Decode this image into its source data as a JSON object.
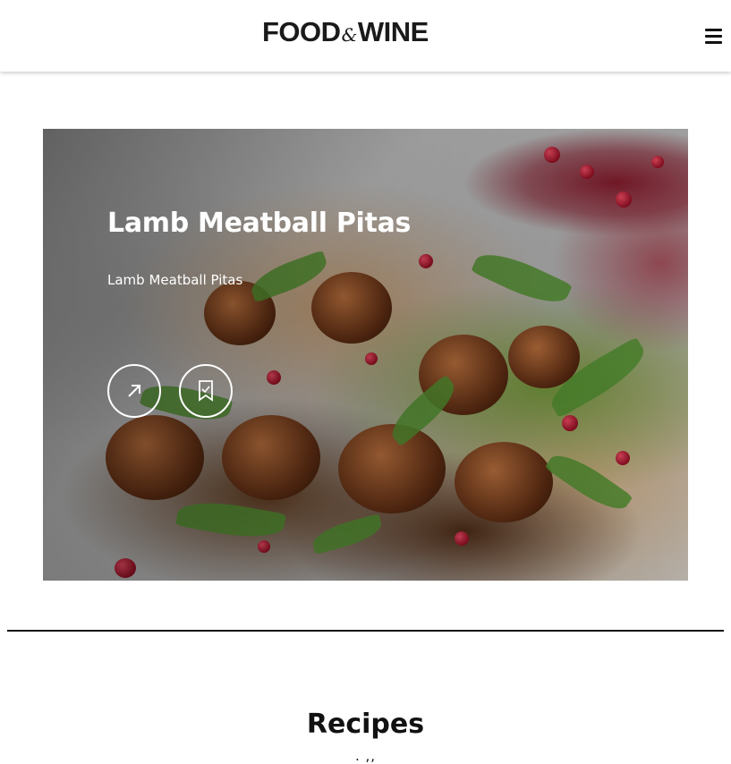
{
  "header": {
    "logo_left": "FOOD",
    "logo_amp": "&",
    "logo_right": "WINE",
    "menu_icon": "hamburger-menu-icon"
  },
  "hero": {
    "title": "Lamb Meatball Pitas",
    "subtitle": "Lamb Meatball Pitas",
    "open_icon": "arrow-up-right-icon",
    "save_icon": "bookmark-icon"
  },
  "section": {
    "heading": "Recipes",
    "subheading_partial": ". ,,"
  },
  "colors": {
    "text": "#111111",
    "background": "#ffffff",
    "hero_text": "#ffffff"
  }
}
